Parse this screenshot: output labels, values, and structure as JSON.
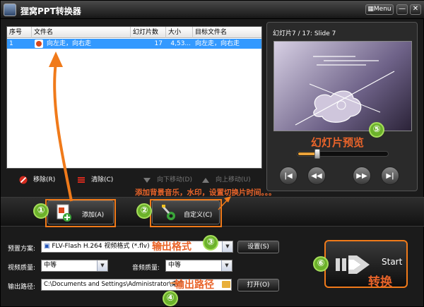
{
  "window": {
    "title": "狸窝PPT转换器",
    "menu_label": "Menu",
    "minimize_label": "—",
    "close_label": "✕"
  },
  "file_list": {
    "columns": [
      "序号",
      "文件名",
      "幻灯片数",
      "大小",
      "目标文件名"
    ],
    "rows": [
      {
        "index": "1",
        "file_name": "向左走，向右走",
        "slides": "17",
        "size": "4,53...",
        "target_name": "向左走，向右走"
      }
    ],
    "toolbar": {
      "remove_label": "移除(R)",
      "clear_label": "清除(C)",
      "move_down_label": "向下移动(D)",
      "move_up_label": "向上移动(U)"
    }
  },
  "preview": {
    "caption": "幻灯片7 / 17: Slide 7",
    "label": "幻灯片预览",
    "seek_fraction": 0.2,
    "buttons": [
      "first",
      "previous",
      "next",
      "last"
    ]
  },
  "actions": {
    "add_label": "添加(A)",
    "customize_label": "自定义(C)",
    "customize_note": "添加背景音乐，水印，设置切换片时间。。。"
  },
  "settings": {
    "preset_label": "预置方案:",
    "preset_value": "FLV-Flash H.264 视频格式 (*.flv)",
    "preset_button": "设置(S)",
    "video_quality_label": "视频质量:",
    "video_quality_value": "中等",
    "audio_quality_label": "音频质量:",
    "audio_quality_value": "中等",
    "output_path_label": "输出路径:",
    "output_path_value": "C:\\Documents and Settings\\Administrator\\桌面",
    "open_button": "打开(O)"
  },
  "start": {
    "label": "Start",
    "label_cn": "转换"
  },
  "annotations": {
    "badges": [
      "①",
      "②",
      "③",
      "④",
      "⑤",
      "⑥"
    ],
    "output_format": "输出格式",
    "output_path": "输出路径"
  },
  "colors": {
    "accent_orange": "#f07a1a",
    "annotation_text": "#e9642a",
    "badge_green": "#6cb22b",
    "selection_blue": "#3399ff"
  }
}
